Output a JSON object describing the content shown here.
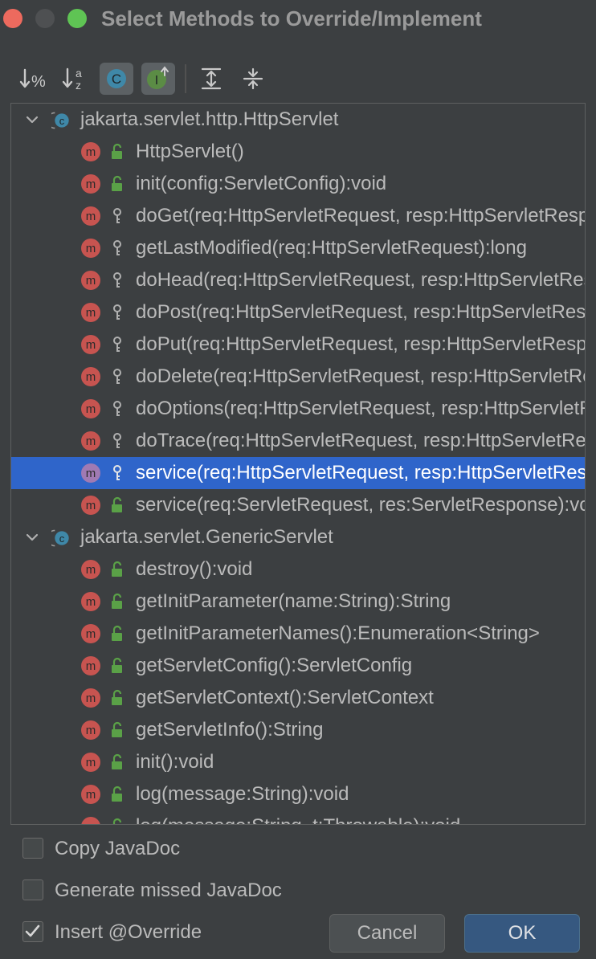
{
  "window": {
    "title": "Select Methods to Override/Implement"
  },
  "toolbar": {
    "buttons": [
      {
        "icon": "sort-by-visibility-icon",
        "toggled": false
      },
      {
        "icon": "sort-alphabetically-icon",
        "toggled": false
      },
      {
        "icon": "show-classes-icon",
        "toggled": true
      },
      {
        "icon": "show-interfaces-icon",
        "toggled": true
      },
      {
        "icon": "expand-all-icon",
        "toggled": false
      },
      {
        "icon": "collapse-all-icon",
        "toggled": false
      }
    ]
  },
  "tree": {
    "groups": [
      {
        "label": "jakarta.servlet.http.HttpServlet",
        "expanded": true,
        "methods": [
          {
            "label": "HttpServlet()",
            "visibility": "public"
          },
          {
            "label": "init(config:ServletConfig):void",
            "visibility": "public"
          },
          {
            "label": "doGet(req:HttpServletRequest, resp:HttpServletResponse):void",
            "visibility": "protected"
          },
          {
            "label": "getLastModified(req:HttpServletRequest):long",
            "visibility": "protected"
          },
          {
            "label": "doHead(req:HttpServletRequest, resp:HttpServletResponse):void",
            "visibility": "protected"
          },
          {
            "label": "doPost(req:HttpServletRequest, resp:HttpServletResponse):void",
            "visibility": "protected"
          },
          {
            "label": "doPut(req:HttpServletRequest, resp:HttpServletResponse):void",
            "visibility": "protected"
          },
          {
            "label": "doDelete(req:HttpServletRequest, resp:HttpServletResponse):void",
            "visibility": "protected"
          },
          {
            "label": "doOptions(req:HttpServletRequest, resp:HttpServletResponse):void",
            "visibility": "protected"
          },
          {
            "label": "doTrace(req:HttpServletRequest, resp:HttpServletResponse):void",
            "visibility": "protected"
          },
          {
            "label": "service(req:HttpServletRequest, resp:HttpServletResponse):void",
            "visibility": "protected",
            "selected": true
          },
          {
            "label": "service(req:ServletRequest, res:ServletResponse):void",
            "visibility": "public"
          }
        ]
      },
      {
        "label": "jakarta.servlet.GenericServlet",
        "expanded": true,
        "methods": [
          {
            "label": "destroy():void",
            "visibility": "public"
          },
          {
            "label": "getInitParameter(name:String):String",
            "visibility": "public"
          },
          {
            "label": "getInitParameterNames():Enumeration<String>",
            "visibility": "public"
          },
          {
            "label": "getServletConfig():ServletConfig",
            "visibility": "public"
          },
          {
            "label": "getServletContext():ServletContext",
            "visibility": "public"
          },
          {
            "label": "getServletInfo():String",
            "visibility": "public"
          },
          {
            "label": "init():void",
            "visibility": "public"
          },
          {
            "label": "log(message:String):void",
            "visibility": "public"
          },
          {
            "label": "log(message:String, t:Throwable):void",
            "visibility": "public"
          }
        ]
      }
    ]
  },
  "options": {
    "copy_javadoc": {
      "label": "Copy JavaDoc",
      "checked": false
    },
    "generate_missed_javadoc": {
      "label": "Generate missed JavaDoc",
      "checked": false
    },
    "insert_override": {
      "label": "Insert @Override",
      "checked": true
    }
  },
  "buttons": {
    "cancel": "Cancel",
    "ok": "OK"
  },
  "colors": {
    "background": "#3c3f41",
    "selection": "#2f65ca",
    "method_icon": "#c75450",
    "class_icon": "#3f88a8",
    "public_lock": "#5aa147",
    "ok_button": "#365880"
  }
}
